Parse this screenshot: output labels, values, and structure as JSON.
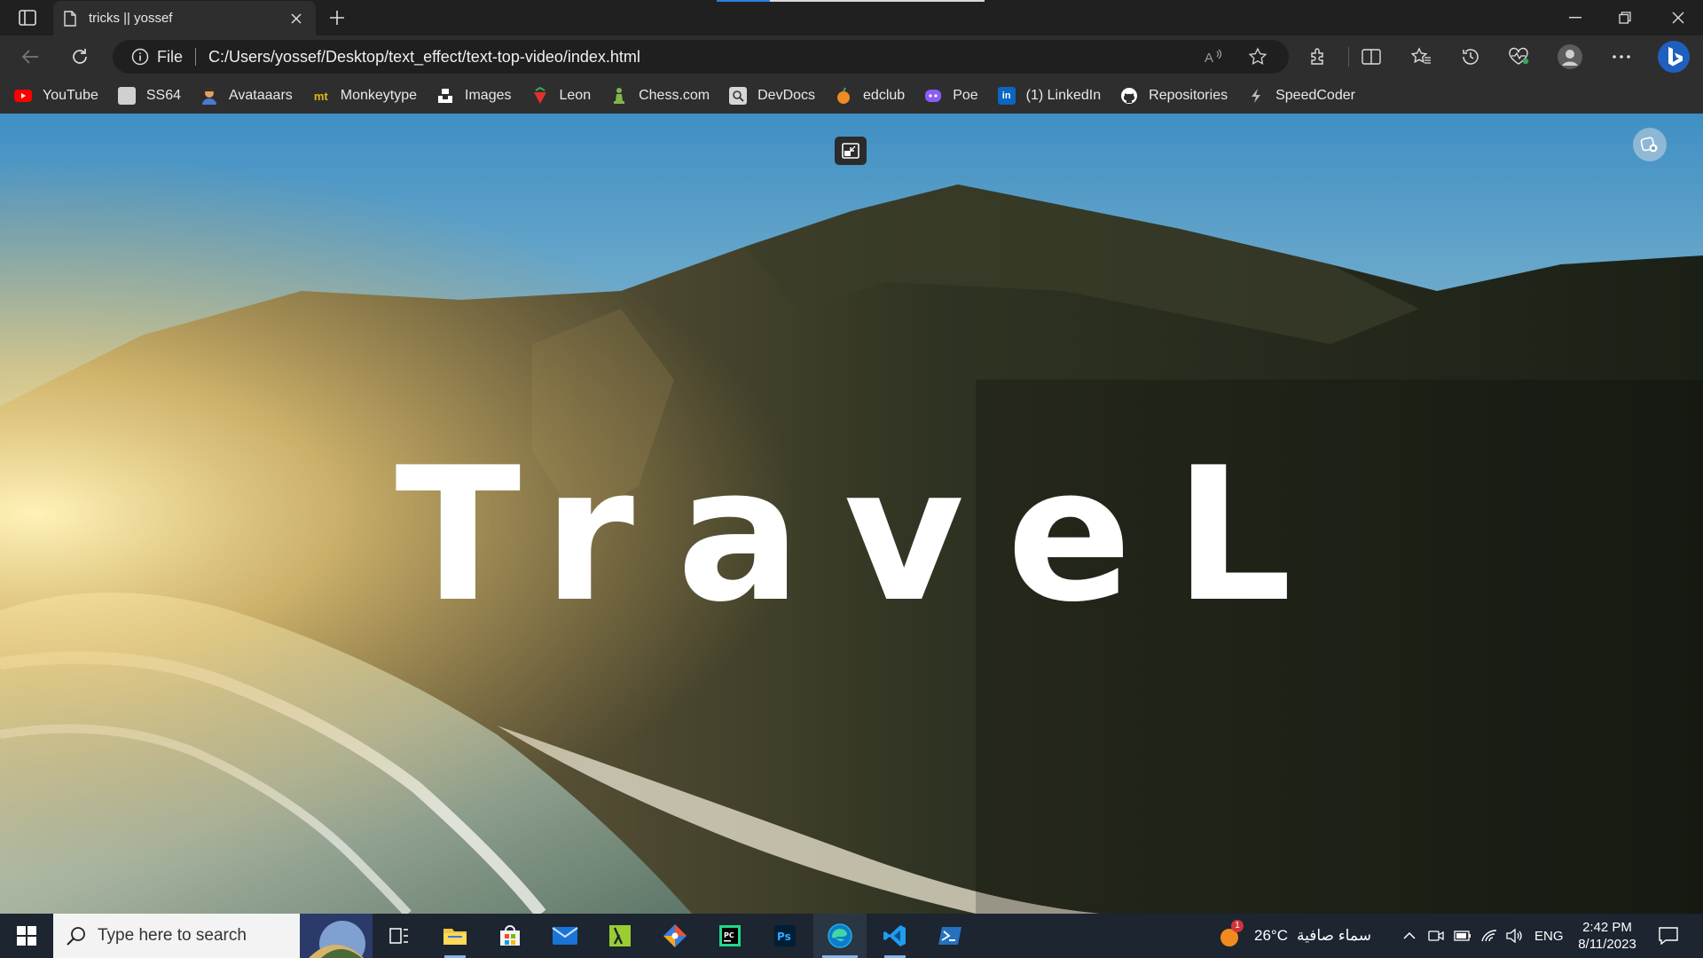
{
  "browser": {
    "tab_title": "tricks || yossef",
    "url_scheme": "File",
    "url": "C:/Users/yossef/Desktop/text_effect/text-top-video/index.html"
  },
  "favorites": [
    {
      "label": "YouTube",
      "icon": "youtube-icon",
      "color": "#ff0000"
    },
    {
      "label": "SS64",
      "icon": "ss64-icon",
      "color": "#d0d0d0"
    },
    {
      "label": "Avataaars",
      "icon": "avatar-icon",
      "color": "#e0a060"
    },
    {
      "label": "Monkeytype",
      "icon": "monkeytype-icon",
      "color": "#e2b714"
    },
    {
      "label": "Images",
      "icon": "unsplash-icon",
      "color": "#ffffff"
    },
    {
      "label": "Leon",
      "icon": "leon-icon",
      "color": "#e03030"
    },
    {
      "label": "Chess.com",
      "icon": "chess-icon",
      "color": "#81b64c"
    },
    {
      "label": "DevDocs",
      "icon": "devdocs-icon",
      "color": "#cccccc"
    },
    {
      "label": "edclub",
      "icon": "edclub-icon",
      "color": "#f08a24"
    },
    {
      "label": "Poe",
      "icon": "poe-icon",
      "color": "#8b5cf6"
    },
    {
      "label": "(1) LinkedIn",
      "icon": "linkedin-icon",
      "color": "#0a66c2"
    },
    {
      "label": "Repositories",
      "icon": "github-icon",
      "color": "#ffffff"
    },
    {
      "label": "SpeedCoder",
      "icon": "speedcoder-icon",
      "color": "#cccccc"
    }
  ],
  "page": {
    "headline": "TraveL"
  },
  "taskbar": {
    "search_placeholder": "Type here to search",
    "weather_temp": "26°C",
    "weather_desc": "سماء صافية",
    "weather_badge": "1",
    "language": "ENG",
    "time": "2:42 PM",
    "date": "8/11/2023"
  }
}
